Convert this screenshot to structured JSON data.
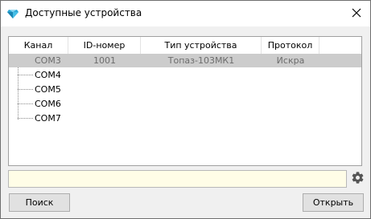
{
  "window": {
    "title": "Доступные устройства"
  },
  "table": {
    "columns": [
      "Канал",
      "ID-номер",
      "Тип устройства",
      "Протокол"
    ],
    "rows": [
      {
        "channel": "COM3",
        "id": "1001",
        "device_type": "Топаз-103МК1",
        "protocol": "Искра",
        "selected": true
      },
      {
        "channel": "COM4",
        "id": "",
        "device_type": "",
        "protocol": "",
        "selected": false
      },
      {
        "channel": "COM5",
        "id": "",
        "device_type": "",
        "protocol": "",
        "selected": false
      },
      {
        "channel": "COM6",
        "id": "",
        "device_type": "",
        "protocol": "",
        "selected": false
      },
      {
        "channel": "COM7",
        "id": "",
        "device_type": "",
        "protocol": "",
        "selected": false
      }
    ]
  },
  "status": {
    "value": ""
  },
  "buttons": {
    "search_label": "Поиск",
    "open_label": "Открыть"
  },
  "icons": {
    "app": "gem-icon",
    "close": "close-icon",
    "settings": "gear-icon"
  },
  "colors": {
    "selected_row": "#cccccc",
    "status_background": "#fffde7",
    "app_icon": "#2aa7d6"
  }
}
